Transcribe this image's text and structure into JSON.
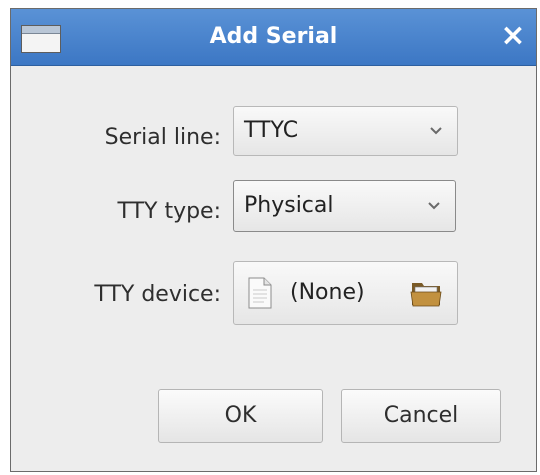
{
  "window": {
    "title": "Add Serial",
    "close_glyph": "×"
  },
  "form": {
    "serial_line": {
      "label": "Serial line:",
      "value": "TTYC"
    },
    "tty_type": {
      "label": "TTY type:",
      "value": "Physical"
    },
    "tty_device": {
      "label": "TTY device:",
      "value": "(None)"
    }
  },
  "buttons": {
    "ok": "OK",
    "cancel": "Cancel"
  },
  "icons": {
    "window": "window-icon",
    "close": "close-icon",
    "dropdown": "chevron-down-icon",
    "file": "file-icon",
    "folder": "folder-icon"
  },
  "colors": {
    "titlebar": "#4a86cf",
    "background": "#ededed"
  }
}
